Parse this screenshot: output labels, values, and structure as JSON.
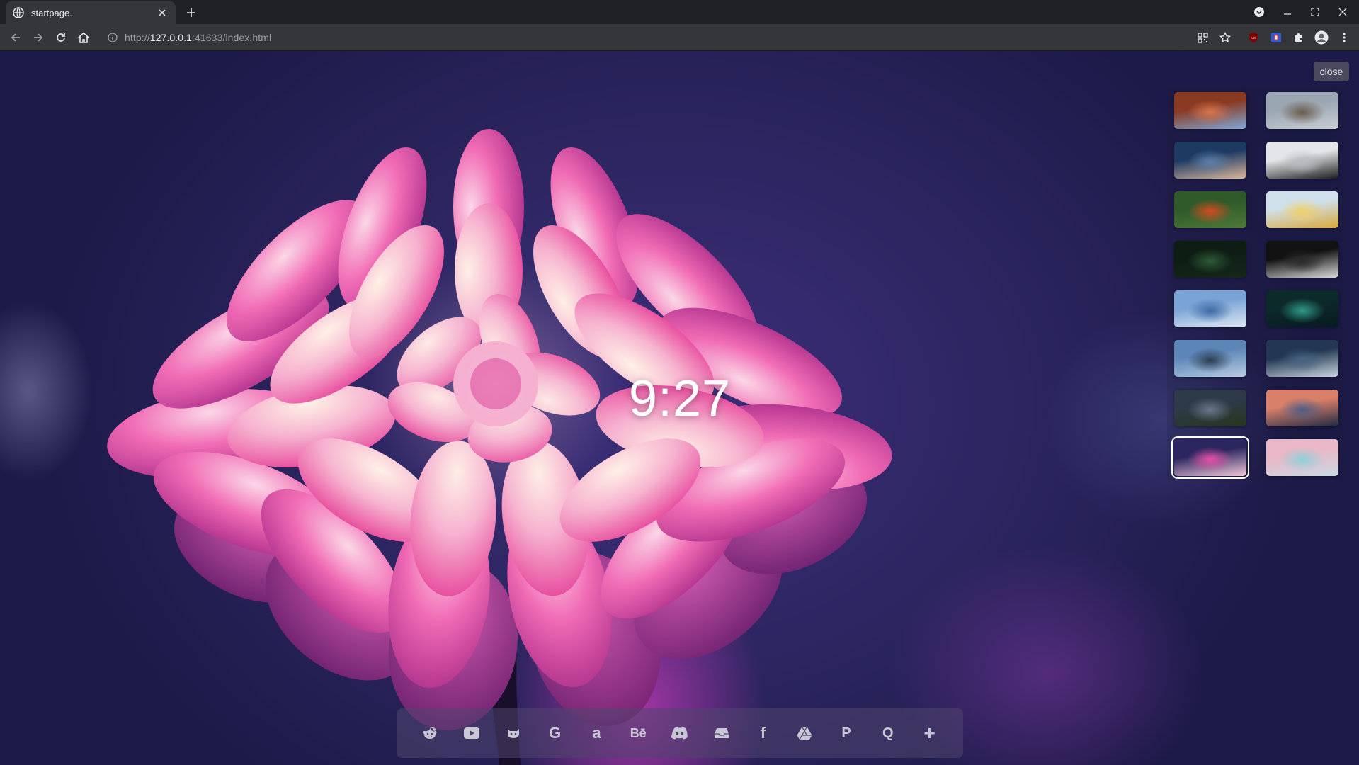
{
  "browser": {
    "tab": {
      "title": "startpage.",
      "favicon": "globe-icon"
    },
    "url": {
      "prefix": "http://",
      "host": "127.0.0.1",
      "rest": ":41633/index.html"
    }
  },
  "page": {
    "clock": "9:27",
    "close_label": "close",
    "wallpapers": [
      {
        "name": "canyon",
        "colors": [
          "#8a3a22",
          "#d9744a",
          "#7fa8d8"
        ],
        "selected": false
      },
      {
        "name": "rocky-mountain",
        "colors": [
          "#9aa6b2",
          "#6b5a4d",
          "#c9ced6"
        ],
        "selected": false
      },
      {
        "name": "ocean-beach",
        "colors": [
          "#1d3a63",
          "#5d7fa8",
          "#d9b79a"
        ],
        "selected": false
      },
      {
        "name": "misty-hill",
        "colors": [
          "#e3e5e8",
          "#b8bbc0",
          "#1e1e1e"
        ],
        "selected": false
      },
      {
        "name": "tulips",
        "colors": [
          "#2f5a2a",
          "#d44b20",
          "#4f7a39"
        ],
        "selected": false
      },
      {
        "name": "yellow-leaves",
        "colors": [
          "#cfe0ea",
          "#f0cf6a",
          "#d8a83a"
        ],
        "selected": false
      },
      {
        "name": "fern",
        "colors": [
          "#0e1d14",
          "#2e5a36",
          "#14281a"
        ],
        "selected": false
      },
      {
        "name": "dark-doorway",
        "colors": [
          "#121212",
          "#2a2a2a",
          "#d9d9d9"
        ],
        "selected": false
      },
      {
        "name": "blue-shore",
        "colors": [
          "#7aa4d6",
          "#3d6aa4",
          "#dfe8f2"
        ],
        "selected": false
      },
      {
        "name": "aurora",
        "colors": [
          "#0d2a2a",
          "#2f9a86",
          "#071a22"
        ],
        "selected": false
      },
      {
        "name": "sea-arch",
        "colors": [
          "#5d86b8",
          "#2b3e52",
          "#b9cde2"
        ],
        "selected": false
      },
      {
        "name": "coastal-road",
        "colors": [
          "#213752",
          "#486482",
          "#c9d4de"
        ],
        "selected": false
      },
      {
        "name": "mountain-forest",
        "colors": [
          "#2e3a4a",
          "#6a7686",
          "#27361f"
        ],
        "selected": false
      },
      {
        "name": "pier-sunset",
        "colors": [
          "#d9806a",
          "#4e5f86",
          "#1f2a44"
        ],
        "selected": false
      },
      {
        "name": "dahlia",
        "colors": [
          "#2b2660",
          "#e64fa6",
          "#f2c8d8"
        ],
        "selected": true
      },
      {
        "name": "glass-building",
        "colors": [
          "#e9b7c7",
          "#8fd0d8",
          "#c9d9e2"
        ],
        "selected": false
      }
    ],
    "dock": [
      {
        "name": "reddit-icon"
      },
      {
        "name": "youtube-icon"
      },
      {
        "name": "github-icon"
      },
      {
        "name": "google-icon",
        "glyph": "G"
      },
      {
        "name": "amazon-icon",
        "glyph": "a"
      },
      {
        "name": "behance-icon",
        "glyph": "Bē"
      },
      {
        "name": "discord-icon"
      },
      {
        "name": "inbox-icon"
      },
      {
        "name": "facebook-icon",
        "glyph": "f"
      },
      {
        "name": "google-drive-icon"
      },
      {
        "name": "pinterest-icon",
        "glyph": "P"
      },
      {
        "name": "quora-icon",
        "glyph": "Q"
      },
      {
        "name": "add-icon",
        "glyph": "+"
      }
    ]
  }
}
